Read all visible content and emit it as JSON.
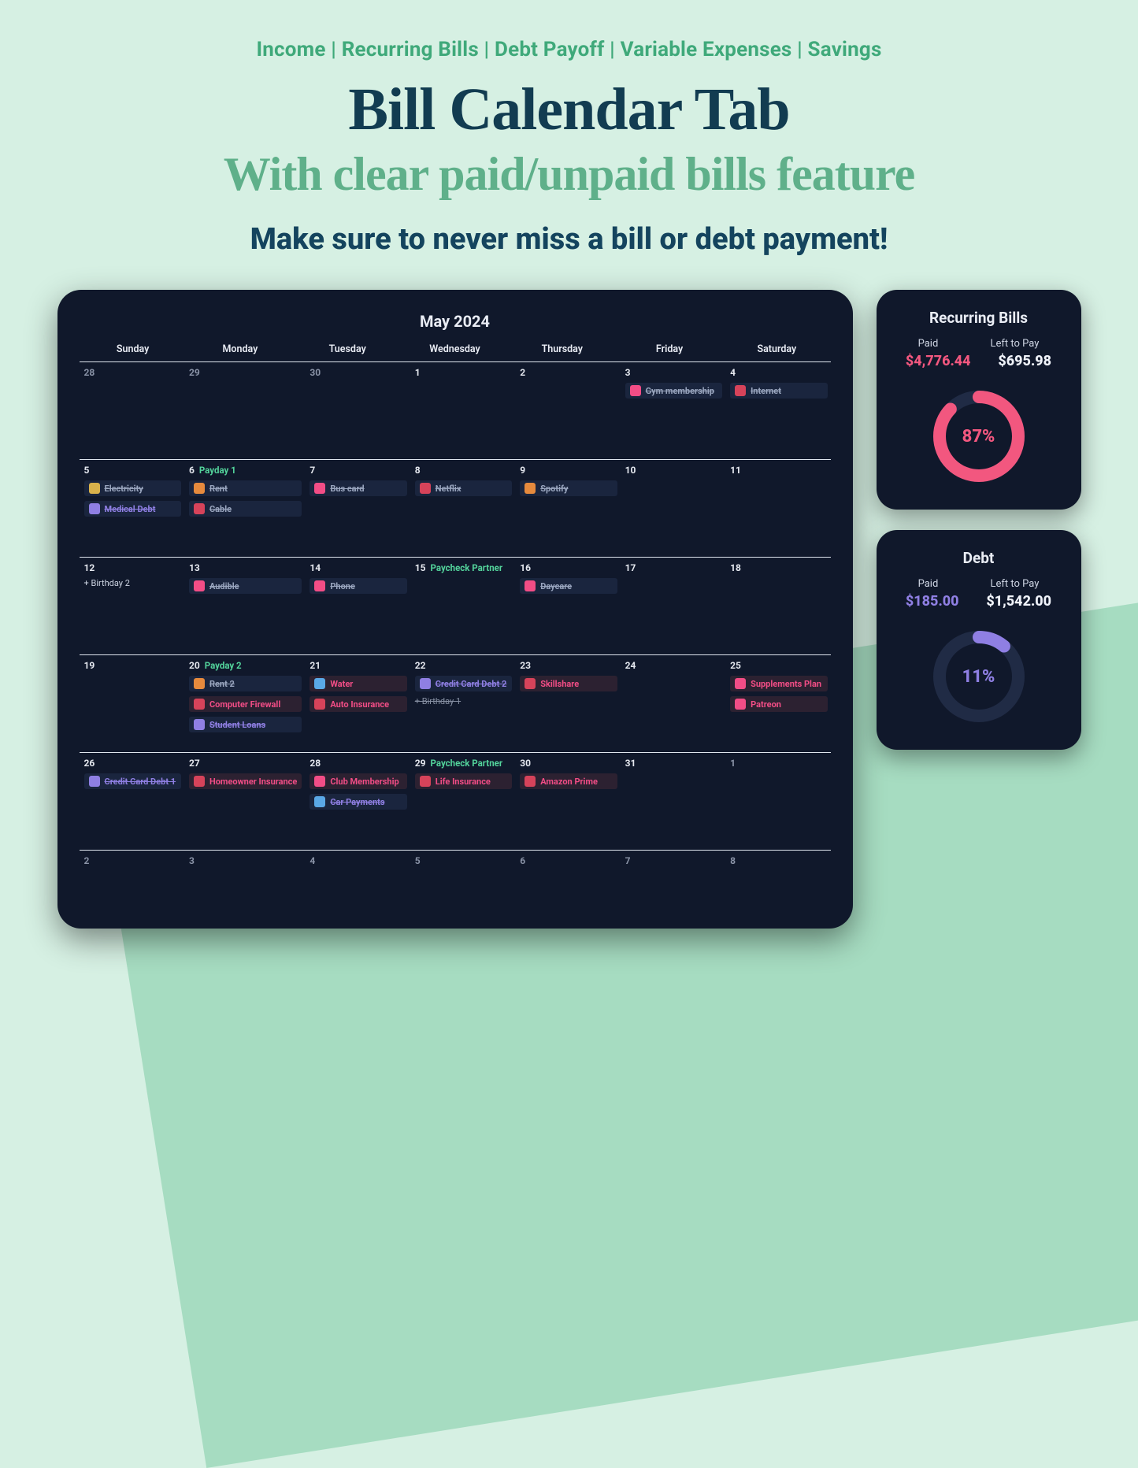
{
  "hero": {
    "tags": "Income | Recurring Bills | Debt Payoff | Variable Expenses | Savings",
    "title": "Bill Calendar Tab",
    "sub": "With clear paid/unpaid bills feature",
    "line": "Make sure to never miss a bill or debt payment!"
  },
  "calendar": {
    "month": "May 2024",
    "weekdays": [
      "Sunday",
      "Monday",
      "Tuesday",
      "Wednesday",
      "Thursday",
      "Friday",
      "Saturday"
    ],
    "weeks": [
      [
        {
          "n": "28",
          "dim": true
        },
        {
          "n": "29",
          "dim": true
        },
        {
          "n": "30",
          "dim": true
        },
        {
          "n": "1"
        },
        {
          "n": "2"
        },
        {
          "n": "3",
          "items": [
            {
              "t": "Gym membership",
              "c": "pink",
              "s": "paid"
            }
          ]
        },
        {
          "n": "4",
          "items": [
            {
              "t": "Internet",
              "c": "red",
              "s": "paid"
            }
          ]
        }
      ],
      [
        {
          "n": "5",
          "items": [
            {
              "t": "Electricity",
              "c": "yellow",
              "s": "paid"
            },
            {
              "t": "Medical Debt",
              "c": "purple",
              "s": "paid",
              "k": "debt"
            }
          ]
        },
        {
          "n": "6",
          "meta": {
            "text": "Payday 1",
            "cls": "meta-green"
          },
          "items": [
            {
              "t": "Rent",
              "c": "orange",
              "s": "paid"
            },
            {
              "t": "Cable",
              "c": "red",
              "s": "paid"
            }
          ]
        },
        {
          "n": "7",
          "items": [
            {
              "t": "Bus card",
              "c": "pink",
              "s": "paid"
            }
          ]
        },
        {
          "n": "8",
          "items": [
            {
              "t": "Netflix",
              "c": "red",
              "s": "paid"
            }
          ]
        },
        {
          "n": "9",
          "items": [
            {
              "t": "Spotify",
              "c": "orange",
              "s": "paid"
            }
          ]
        },
        {
          "n": "10"
        },
        {
          "n": "11"
        }
      ],
      [
        {
          "n": "12",
          "plain": [
            {
              "t": "+  Birthday 2"
            }
          ]
        },
        {
          "n": "13",
          "items": [
            {
              "t": "Audible",
              "c": "pink",
              "s": "paid"
            }
          ]
        },
        {
          "n": "14",
          "items": [
            {
              "t": "Phone",
              "c": "pink",
              "s": "paid"
            }
          ]
        },
        {
          "n": "15",
          "meta": {
            "text": "Paycheck Partner",
            "cls": "meta-green"
          }
        },
        {
          "n": "16",
          "items": [
            {
              "t": "Daycare",
              "c": "pink",
              "s": "paid"
            }
          ]
        },
        {
          "n": "17"
        },
        {
          "n": "18"
        }
      ],
      [
        {
          "n": "19"
        },
        {
          "n": "20",
          "meta": {
            "text": "Payday 2",
            "cls": "meta-green"
          },
          "items": [
            {
              "t": "Rent 2",
              "c": "orange",
              "s": "paid"
            },
            {
              "t": "Computer Firewall",
              "c": "red",
              "s": "unpaid"
            },
            {
              "t": "Student Loans",
              "c": "purple",
              "s": "paid",
              "k": "debt"
            }
          ]
        },
        {
          "n": "21",
          "items": [
            {
              "t": "Water",
              "c": "blue",
              "s": "unpaid"
            },
            {
              "t": "Auto Insurance",
              "c": "red",
              "s": "unpaid"
            }
          ]
        },
        {
          "n": "22",
          "items": [
            {
              "t": "Credit Card Debt 2",
              "c": "purple",
              "s": "paid",
              "k": "debt"
            }
          ],
          "plain": [
            {
              "t": "+  Birthday 1",
              "strike": true
            }
          ]
        },
        {
          "n": "23",
          "items": [
            {
              "t": "Skillshare",
              "c": "red",
              "s": "unpaid"
            }
          ]
        },
        {
          "n": "24"
        },
        {
          "n": "25",
          "items": [
            {
              "t": "Supplements Plan",
              "c": "pink",
              "s": "unpaid"
            },
            {
              "t": "Patreon",
              "c": "pink",
              "s": "unpaid"
            }
          ]
        }
      ],
      [
        {
          "n": "26",
          "items": [
            {
              "t": "Credit Card Debt 1",
              "c": "purple",
              "s": "paid",
              "k": "debt"
            }
          ]
        },
        {
          "n": "27",
          "items": [
            {
              "t": "Homeowner Insurance",
              "c": "red",
              "s": "unpaid"
            }
          ]
        },
        {
          "n": "28",
          "items": [
            {
              "t": "Club Membership",
              "c": "pink",
              "s": "unpaid"
            },
            {
              "t": "Car Payments",
              "c": "blue",
              "s": "paid",
              "k": "debt"
            }
          ]
        },
        {
          "n": "29",
          "meta": {
            "text": "Paycheck Partner",
            "cls": "meta-green"
          },
          "items": [
            {
              "t": "Life Insurance",
              "c": "red",
              "s": "unpaid"
            }
          ]
        },
        {
          "n": "30",
          "items": [
            {
              "t": "Amazon Prime",
              "c": "red",
              "s": "unpaid"
            }
          ]
        },
        {
          "n": "31"
        },
        {
          "n": "1",
          "dim": true
        }
      ],
      [
        {
          "n": "2",
          "dim": true
        },
        {
          "n": "3",
          "dim": true
        },
        {
          "n": "4",
          "dim": true
        },
        {
          "n": "5",
          "dim": true
        },
        {
          "n": "6",
          "dim": true
        },
        {
          "n": "7",
          "dim": true
        },
        {
          "n": "8",
          "dim": true
        }
      ]
    ]
  },
  "side": {
    "recurring": {
      "title": "Recurring Bills",
      "paid_label": "Paid",
      "left_label": "Left to Pay",
      "paid": "$4,776.44",
      "left": "$695.98",
      "pct": "87%",
      "pct_value": 87,
      "color": "pink",
      "ring": "#f2577f"
    },
    "debt": {
      "title": "Debt",
      "paid_label": "Paid",
      "left_label": "Left to Pay",
      "paid": "$185.00",
      "left": "$1,542.00",
      "pct": "11%",
      "pct_value": 11,
      "color": "purple",
      "ring": "#8f7fe3"
    }
  },
  "chart_data": [
    {
      "type": "pie",
      "title": "Recurring Bills",
      "series": [
        {
          "name": "Paid %",
          "values": [
            87
          ]
        },
        {
          "name": "Remaining %",
          "values": [
            13
          ]
        }
      ],
      "categories": [
        "Paid",
        "Remaining"
      ],
      "annotations": {
        "paid": "$4,776.44",
        "left_to_pay": "$695.98"
      }
    },
    {
      "type": "pie",
      "title": "Debt",
      "series": [
        {
          "name": "Paid %",
          "values": [
            11
          ]
        },
        {
          "name": "Remaining %",
          "values": [
            89
          ]
        }
      ],
      "categories": [
        "Paid",
        "Remaining"
      ],
      "annotations": {
        "paid": "$185.00",
        "left_to_pay": "$1,542.00"
      }
    }
  ]
}
